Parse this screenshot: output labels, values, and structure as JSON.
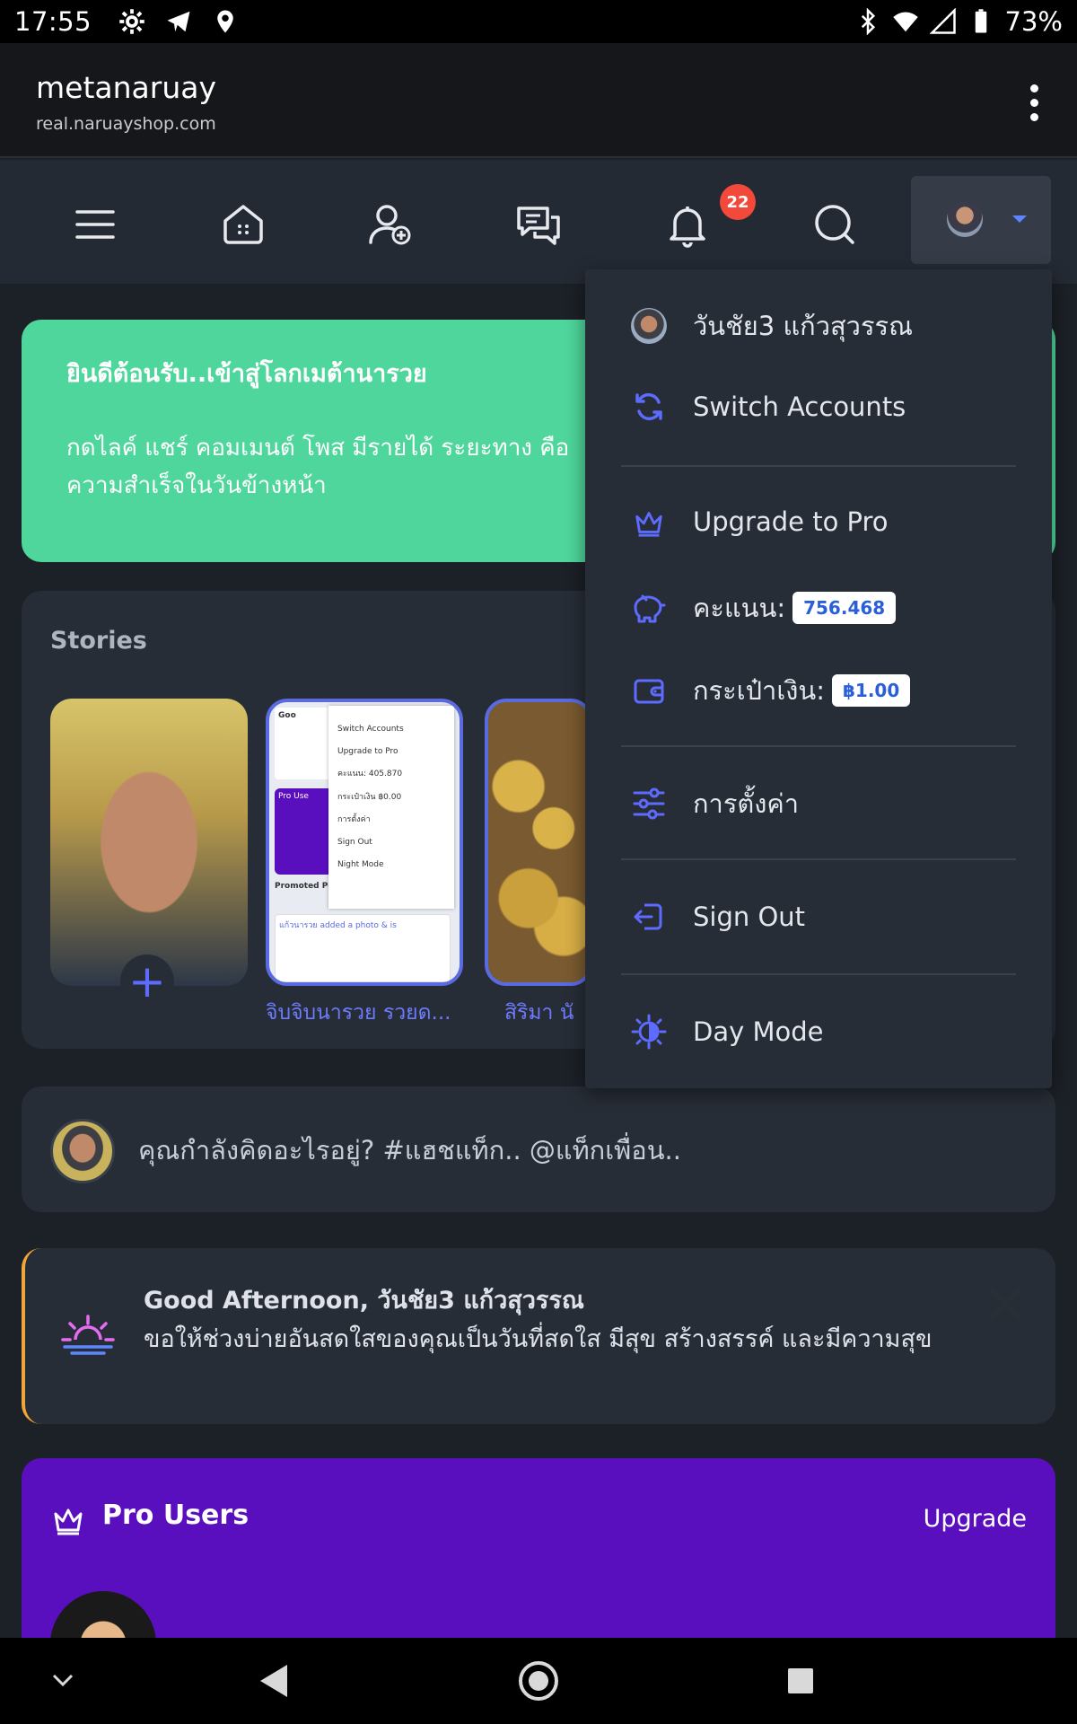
{
  "status_bar": {
    "time": "17:55",
    "battery": "73%"
  },
  "browser": {
    "site_name": "metanaruay",
    "url": "real.naruayshop.com"
  },
  "nav": {
    "notification_count": "22"
  },
  "welcome": {
    "title": "ยินดีต้อนรับ..เข้าสู่โลกเมต้านารวย",
    "body": " กดไลค์ แชร์ คอมเมนต์ โพส มีรายได้ ระยะทาง คือความสำเร็จในวันข้างหน้า"
  },
  "stories": {
    "title": "Stories",
    "items": [
      {
        "name": ""
      },
      {
        "name": "จิบจิบนารวย รวยด..."
      },
      {
        "name": "สิริมา นั"
      }
    ],
    "mini": {
      "menu_items": [
        "Switch Accounts",
        "Upgrade to Pro",
        "คะแนน: 405.870",
        "กระเป๋าเงิน ฿0.00",
        "การตั้งค่า",
        "Sign Out",
        "Night Mode"
      ],
      "promoted": "Promoted Po",
      "pro": "Pro Use",
      "good": "Goo",
      "post_text": "แก้วนารวย added a photo & is"
    }
  },
  "composer": {
    "placeholder": "คุณกำลังคิดอะไรอยู่? #แฮชแท็ก.. @แท็กเพื่อน.."
  },
  "greeting": {
    "title": "Good Afternoon, วันชัย3 แก้วสุวรรณ",
    "message": "ขอให้ช่วงบ่ายอันสดใสของคุณเป็นวันที่สดใส มีสุข สร้างสรรค์ และมีความสุข"
  },
  "pro_users": {
    "title": "Pro Users",
    "upgrade": "Upgrade"
  },
  "dropdown": {
    "user_name": "วันชัย3 แก้วสุวรรณ",
    "switch_accounts": "Switch Accounts",
    "upgrade_pro": "Upgrade to Pro",
    "points_label": "คะแนน:",
    "points_value": "756.468",
    "wallet_label": "กระเป๋าเงิน:",
    "wallet_value": "฿1.00",
    "settings": "การตั้งค่า",
    "sign_out": "Sign Out",
    "day_mode": "Day Mode"
  },
  "colors": {
    "accent": "#5d6bff",
    "welcome_bg": "#4fd69c",
    "pro_bg": "#5a0fbf",
    "badge": "#f2493b"
  },
  "icons": [
    "settings-icon",
    "telegram-icon",
    "location-icon",
    "bluetooth-icon",
    "wifi-icon",
    "signal-icon",
    "battery-icon",
    "menu-icon",
    "home-icon",
    "add-user-icon",
    "chat-icon",
    "bell-icon",
    "search-icon",
    "crown-icon",
    "sync-icon",
    "piggy-bank-icon",
    "wallet-icon",
    "sliders-icon",
    "sign-out-icon",
    "day-mode-icon",
    "sunset-icon",
    "close-icon"
  ]
}
